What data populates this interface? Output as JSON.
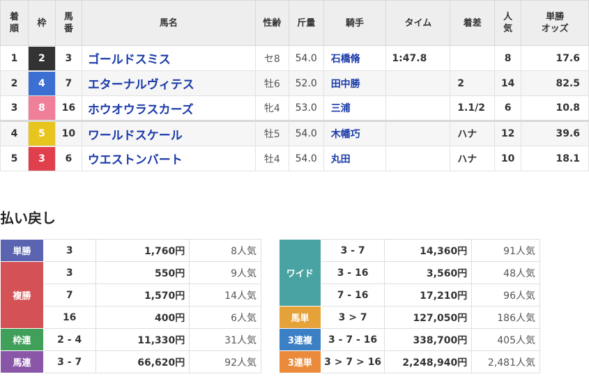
{
  "headers": {
    "pos": "着順",
    "frame": "枠",
    "num": "馬番",
    "name": "馬名",
    "sex_age": "性齢",
    "weight": "斤量",
    "jockey": "騎手",
    "time": "タイム",
    "margin": "着差",
    "pop": "人気",
    "odds": "単勝オッズ"
  },
  "headers_split": {
    "pos": [
      "着",
      "順"
    ],
    "num": [
      "馬",
      "番"
    ],
    "pop": [
      "人",
      "気"
    ],
    "odds": [
      "単勝",
      "オッズ"
    ]
  },
  "results": [
    {
      "pos": "1",
      "frame": "2",
      "frame_color": "#333333",
      "num": "3",
      "name": "ゴールドスミス",
      "sex_age": "セ8",
      "weight": "54.0",
      "jockey": "石橋脩",
      "time": "1:47.8",
      "margin": "",
      "pop": "8",
      "odds": "17.6"
    },
    {
      "pos": "2",
      "frame": "4",
      "frame_color": "#3b6fd1",
      "num": "7",
      "name": "エターナルヴィテス",
      "sex_age": "牡6",
      "weight": "52.0",
      "jockey": "田中勝",
      "time": "",
      "margin": "2",
      "pop": "14",
      "odds": "82.5"
    },
    {
      "pos": "3",
      "frame": "8",
      "frame_color": "#f07f9a",
      "num": "16",
      "name": "ホウオウラスカーズ",
      "sex_age": "牝4",
      "weight": "53.0",
      "jockey": "三浦",
      "time": "",
      "margin": "1.1/2",
      "pop": "6",
      "odds": "10.8"
    },
    {
      "pos": "4",
      "frame": "5",
      "frame_color": "#e8c51e",
      "num": "10",
      "name": "ワールドスケール",
      "sex_age": "牡5",
      "weight": "54.0",
      "jockey": "木幡巧",
      "time": "",
      "margin": "ハナ",
      "pop": "12",
      "odds": "39.6"
    },
    {
      "pos": "5",
      "frame": "3",
      "frame_color": "#e0404c",
      "num": "6",
      "name": "ウエストンバート",
      "sex_age": "牡4",
      "weight": "54.0",
      "jockey": "丸田",
      "time": "",
      "margin": "ハナ",
      "pop": "10",
      "odds": "18.1"
    }
  ],
  "payout_heading": "払い戻し",
  "payouts_left": [
    {
      "label": "単勝",
      "color": "#5a64b0",
      "rows": [
        {
          "combo": "3",
          "amount": "1,760円",
          "pop": "8人気"
        }
      ]
    },
    {
      "label": "複勝",
      "color": "#d45256",
      "rows": [
        {
          "combo": "3",
          "amount": "550円",
          "pop": "9人気"
        },
        {
          "combo": "7",
          "amount": "1,570円",
          "pop": "14人気"
        },
        {
          "combo": "16",
          "amount": "400円",
          "pop": "6人気"
        }
      ]
    },
    {
      "label": "枠連",
      "color": "#40a05a",
      "rows": [
        {
          "combo": "2 - 4",
          "amount": "11,330円",
          "pop": "31人気"
        }
      ]
    },
    {
      "label": "馬連",
      "color": "#8a56a8",
      "rows": [
        {
          "combo": "3 - 7",
          "amount": "66,620円",
          "pop": "92人気"
        }
      ]
    }
  ],
  "payouts_right": [
    {
      "label": "ワイド",
      "color": "#4aa3a3",
      "rows": [
        {
          "combo": "3 - 7",
          "amount": "14,360円",
          "pop": "91人気"
        },
        {
          "combo": "3 - 16",
          "amount": "3,560円",
          "pop": "48人気"
        },
        {
          "combo": "7 - 16",
          "amount": "17,210円",
          "pop": "96人気"
        }
      ]
    },
    {
      "label": "馬単",
      "color": "#e4a238",
      "rows": [
        {
          "combo": "3 > 7",
          "amount": "127,050円",
          "pop": "186人気"
        }
      ]
    },
    {
      "label": "3連複",
      "color": "#3b7fc4",
      "rows": [
        {
          "combo": "3 - 7 - 16",
          "amount": "338,700円",
          "pop": "405人気"
        }
      ]
    },
    {
      "label": "3連単",
      "color": "#ea8a3a",
      "rows": [
        {
          "combo": "3 > 7 > 16",
          "amount": "2,248,940円",
          "pop": "2,481人気"
        }
      ]
    }
  ]
}
